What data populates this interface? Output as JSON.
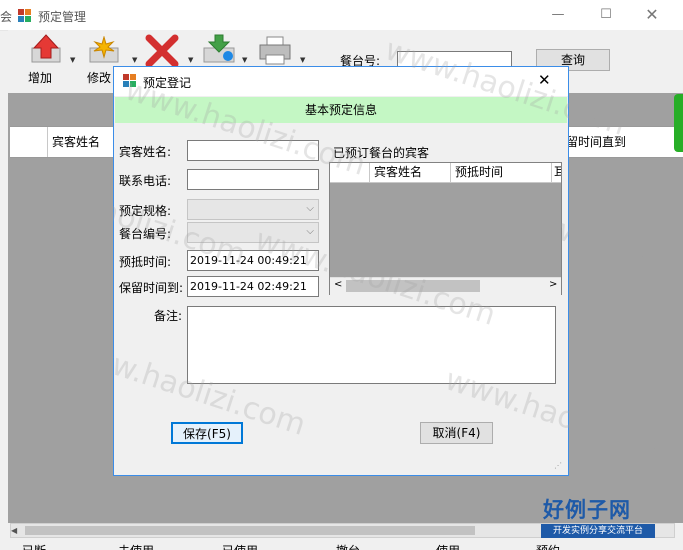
{
  "main_window": {
    "title": "预定管理",
    "side_text": "会"
  },
  "toolbar": {
    "add_label": "增加",
    "edit_label": "修改",
    "table_no_label": "餐台号:",
    "table_no_value": "",
    "query_label": "查询"
  },
  "grid": {
    "columns": [
      "宾客姓名",
      "留时间直到"
    ]
  },
  "bottom_tabs": [
    "已断",
    "未使用",
    "已使用",
    "撤台",
    "使用",
    "预约"
  ],
  "dialog": {
    "title": "预定登记",
    "banner": "基本预定信息",
    "guest_name_label": "宾客姓名:",
    "guest_name_value": "",
    "phone_label": "联系电话:",
    "phone_value": "",
    "spec_label": "预定规格:",
    "spec_value": "",
    "table_code_label": "餐台编号:",
    "table_code_value": "",
    "arrive_label": "预抵时间:",
    "arrive_value": "2019-11-24 00:49:21",
    "keep_label": "保留时间到:",
    "keep_value": "2019-11-24 02:49:21",
    "remark_label": "备注:",
    "remark_value": "",
    "booked_label": "已预订餐台的宾客",
    "booked_columns": [
      "宾客姓名",
      "预抵时间",
      "耳"
    ],
    "save_label": "保存(F5)",
    "cancel_label": "取消(F4)"
  },
  "watermark": {
    "text": "www.haolizi.com",
    "logo_main": "好例子网",
    "logo_sub": "开发实例分享交流平台"
  },
  "colors": {
    "banner": "#c4f7c4",
    "grid_bg": "#a0a0a0",
    "dialog_border": "#3b8de8",
    "logo_blue": "#1e5aa8"
  }
}
